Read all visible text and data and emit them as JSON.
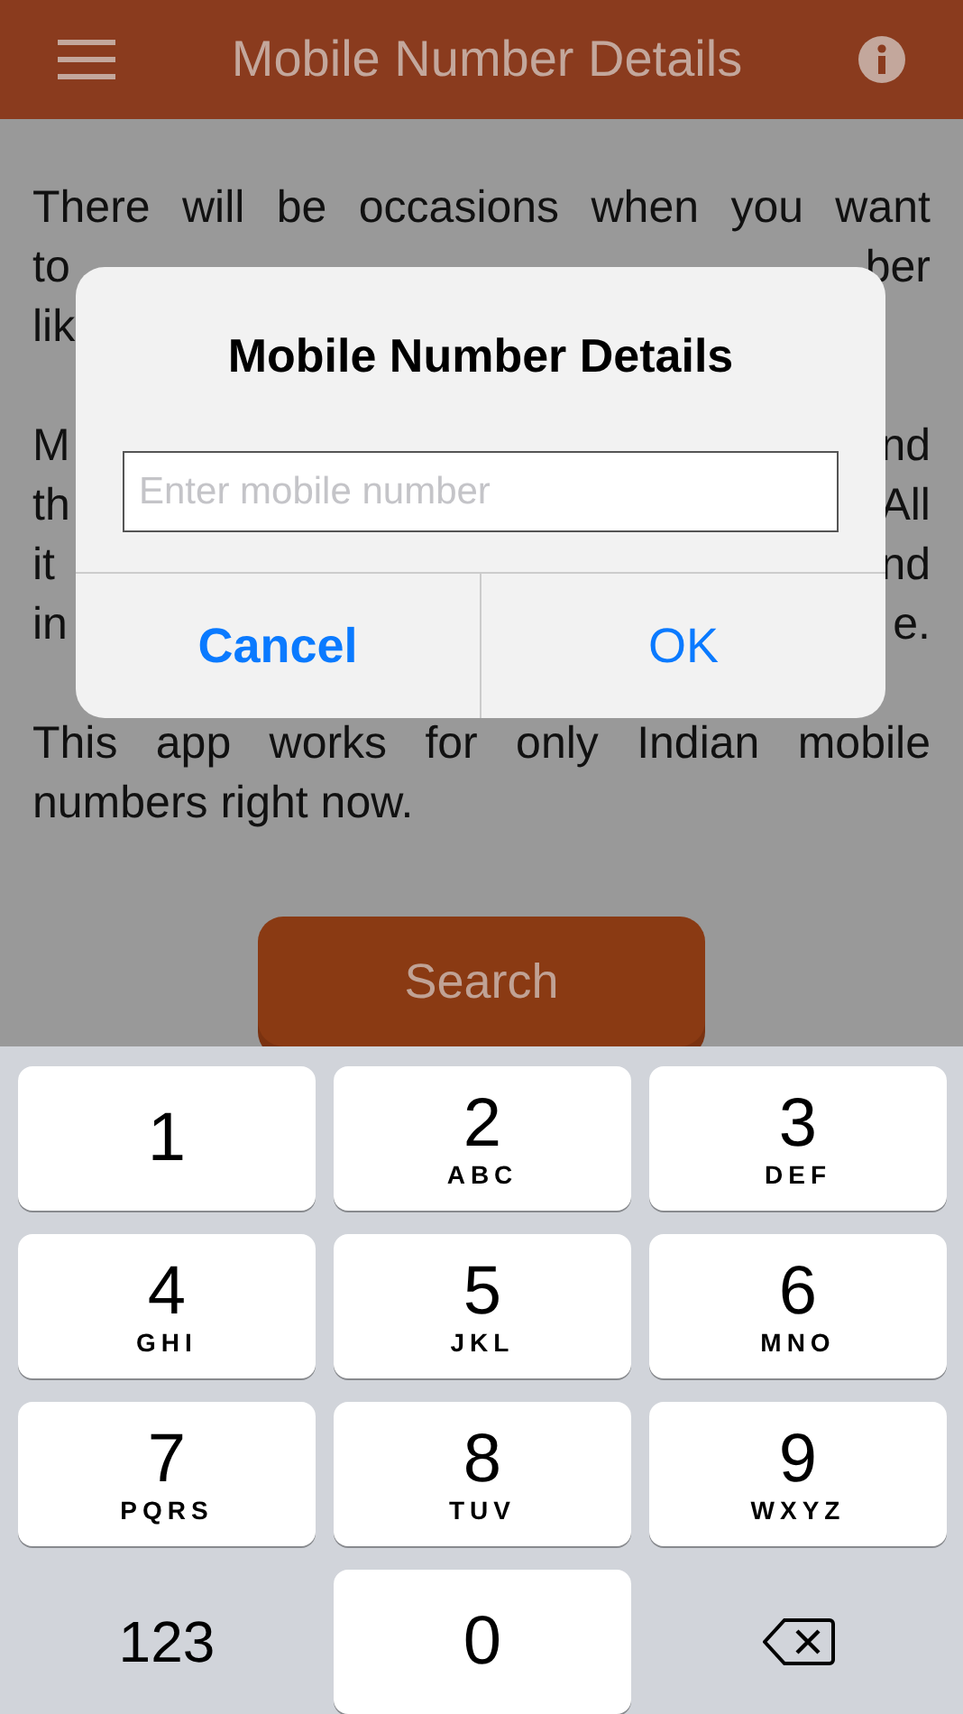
{
  "header": {
    "title": "Mobile Number Details"
  },
  "body": {
    "lines": [
      {
        "kind": "justified",
        "left": "There will be occasions when you want"
      },
      {
        "kind": "cut",
        "left": "to",
        "right": "ber"
      },
      {
        "kind": "cut",
        "left": "lik"
      },
      {
        "kind": "gap"
      },
      {
        "kind": "cut",
        "left": "M",
        "right": "nd"
      },
      {
        "kind": "cut",
        "left": "th",
        "right": "All"
      },
      {
        "kind": "cut",
        "left": "it",
        "right": "nd"
      },
      {
        "kind": "cut",
        "left": "in",
        "right": "e."
      },
      {
        "kind": "gap"
      },
      {
        "kind": "justified",
        "left": "This app works for only Indian mobile"
      },
      {
        "kind": "last",
        "left": "numbers right now."
      }
    ],
    "search_button": "Search"
  },
  "dialog": {
    "title": "Mobile Number Details",
    "placeholder": "Enter mobile number",
    "buttons": [
      {
        "label": "Cancel",
        "kind": "cancel"
      },
      {
        "label": "OK",
        "kind": "default"
      }
    ]
  },
  "keyboard": [
    {
      "kind": "digit",
      "digit": "1"
    },
    {
      "kind": "digit",
      "digit": "2",
      "letters": "ABC"
    },
    {
      "kind": "digit",
      "digit": "3",
      "letters": "DEF"
    },
    {
      "kind": "digit",
      "digit": "4",
      "letters": "GHI"
    },
    {
      "kind": "digit",
      "digit": "5",
      "letters": "JKL"
    },
    {
      "kind": "digit",
      "digit": "6",
      "letters": "MNO"
    },
    {
      "kind": "digit",
      "digit": "7",
      "letters": "PQRS"
    },
    {
      "kind": "digit",
      "digit": "8",
      "letters": "TUV"
    },
    {
      "kind": "digit",
      "digit": "9",
      "letters": "WXYZ"
    },
    {
      "kind": "mode",
      "digit": "123"
    },
    {
      "kind": "digit",
      "digit": "0"
    },
    {
      "kind": "delete"
    }
  ]
}
